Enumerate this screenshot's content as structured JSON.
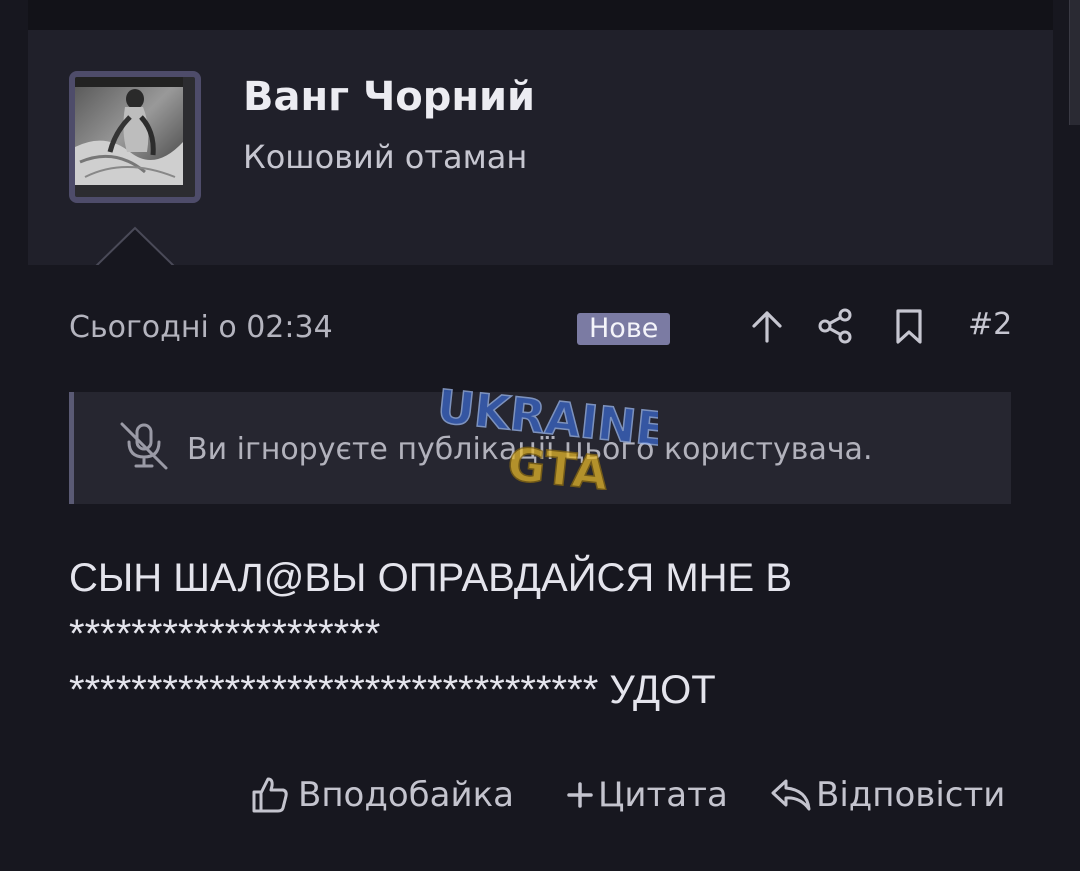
{
  "author": {
    "name": "Ванг Чорний",
    "title": "Кошовий отаман"
  },
  "post": {
    "date": "Сьогодні о 02:34",
    "badge": "Нове",
    "number": "#2",
    "ignored_notice": "Ви ігноруєте публікації цього користувача.",
    "content_lines": [
      "СЫН ШАЛ@ВЫ ОПРАВДАЙСЯ МНЕ В",
      "********************",
      "********************************** УДОТ"
    ]
  },
  "actions": {
    "like": "Вподобайка",
    "quote": "Цитата",
    "reply": "Відповісти"
  },
  "watermark": {
    "line1": "UKRAINE",
    "line2": "GTA"
  },
  "colors": {
    "background": "#17171f",
    "header_bg": "#20202a",
    "badge_bg": "#7b7ba3",
    "notice_bg": "#262630",
    "watermark_blue": "#3a67c9",
    "watermark_yellow": "#e2b52a"
  },
  "icons": [
    "share-up-icon",
    "share-network-icon",
    "bookmark-icon",
    "muted-mic-icon",
    "thumbs-up-icon",
    "plus-icon",
    "reply-icon"
  ]
}
